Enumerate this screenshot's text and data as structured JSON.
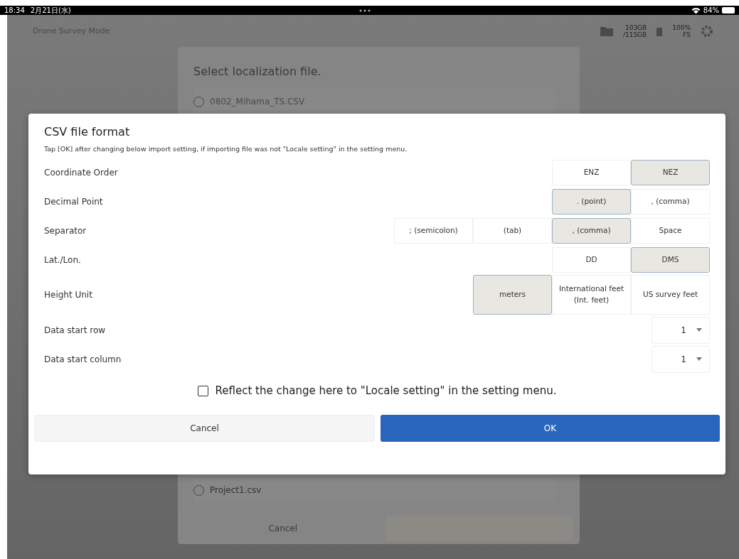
{
  "status_bar": {
    "time": "18:34",
    "date": "2月21日(水)",
    "battery": "84%"
  },
  "toolbar": {
    "mode": "Drone Survey Mode",
    "storage": [
      "103GB",
      "/115GB"
    ],
    "power": [
      "100%",
      "FS"
    ]
  },
  "background_dialog": {
    "title": "Select localization file.",
    "files": [
      {
        "name": "0802_Mihama_TS.CSV",
        "selected": false
      },
      {
        "name": "Project1.csv",
        "selected": false
      }
    ],
    "buttons": [
      {
        "label": "Cancel"
      }
    ]
  },
  "dialog": {
    "title": "CSV file format",
    "note": "Tap [OK] after changing below import setting, if importing file was not \"Locale setting\" in the setting menu.",
    "settings": [
      {
        "label": "Coordinate Order",
        "kind": "segmented",
        "options": [
          {
            "label": "ENZ",
            "selected": false
          },
          {
            "label": "NEZ",
            "selected": true
          }
        ]
      },
      {
        "label": "Decimal Point",
        "kind": "segmented",
        "options": [
          {
            "label": ". (point)",
            "selected": true
          },
          {
            "label": ", (comma)",
            "selected": false
          }
        ]
      },
      {
        "label": "Separator",
        "kind": "segmented",
        "options": [
          {
            "label": "; (semicolon)",
            "selected": false
          },
          {
            "label": "(tab)",
            "selected": false
          },
          {
            "label": ", (comma)",
            "selected": true
          },
          {
            "label": "Space",
            "selected": false
          }
        ]
      },
      {
        "label": "Lat./Lon.",
        "kind": "segmented",
        "options": [
          {
            "label": "DD",
            "selected": false
          },
          {
            "label": "DMS",
            "selected": true
          }
        ]
      },
      {
        "label": "Height Unit",
        "kind": "segmented",
        "options": [
          {
            "label": "meters",
            "selected": true
          },
          {
            "label": "International feet (Int. feet)",
            "selected": false
          },
          {
            "label": "US survey feet",
            "selected": false
          }
        ]
      },
      {
        "label": "Data start row",
        "kind": "dropdown",
        "value": "1"
      },
      {
        "label": "Data start column",
        "kind": "dropdown",
        "value": "1"
      }
    ],
    "checkbox": {
      "label": "Reflect the change here to \"Locale setting\" in the setting menu.",
      "checked": false
    },
    "buttons": [
      {
        "label": "Cancel",
        "kind": "secondary"
      },
      {
        "label": "OK",
        "kind": "primary"
      }
    ]
  }
}
